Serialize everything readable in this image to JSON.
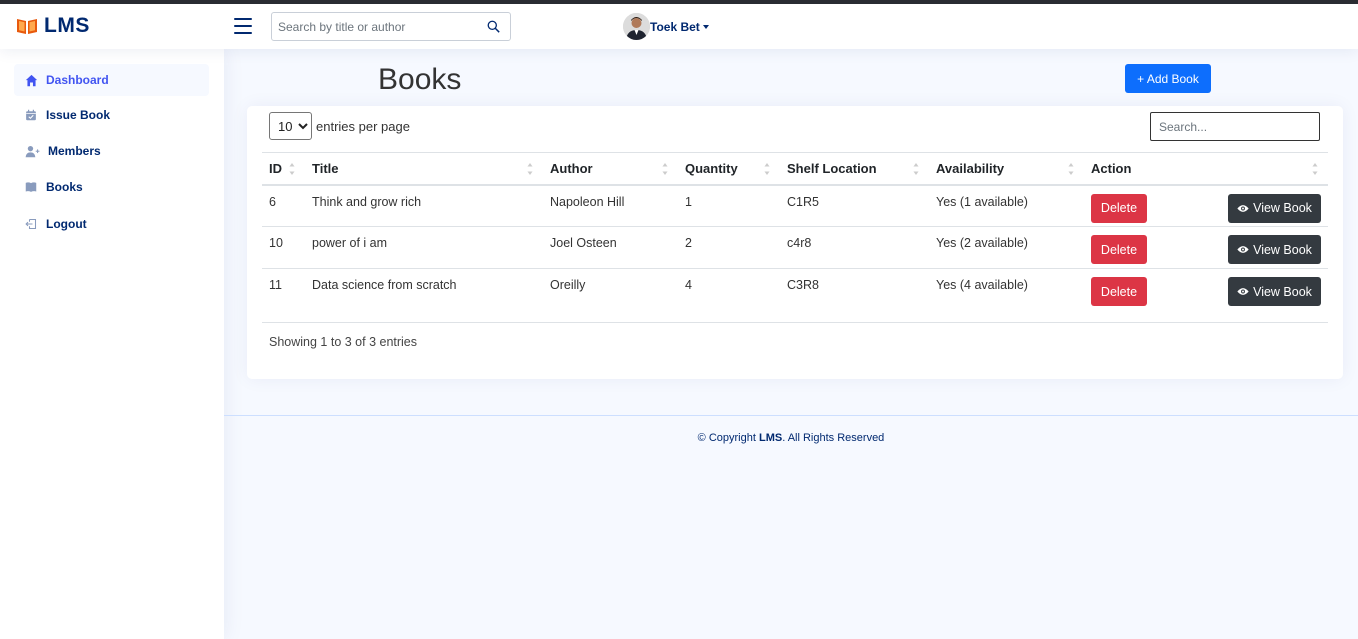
{
  "app": {
    "name": "LMS"
  },
  "header": {
    "search_placeholder": "Search by title or author",
    "user_name": "Toek Bet"
  },
  "sidebar": {
    "items": [
      {
        "label": "Dashboard",
        "icon": "house-icon"
      },
      {
        "label": "Issue Book",
        "icon": "calendar-check-icon"
      },
      {
        "label": "Members",
        "icon": "person-add-icon"
      },
      {
        "label": "Books",
        "icon": "book-icon"
      },
      {
        "label": "Logout",
        "icon": "box-arrow-left-icon"
      }
    ]
  },
  "main": {
    "title": "Books",
    "add_button": "+ Add Book",
    "entries_value": "10",
    "entries_label": "entries per page",
    "table_search_placeholder": "Search...",
    "columns": [
      "ID",
      "Title",
      "Author",
      "Quantity",
      "Shelf Location",
      "Availability",
      "Action"
    ],
    "rows": [
      {
        "id": "6",
        "title": "Think and grow rich",
        "author": "Napoleon Hill",
        "quantity": "1",
        "shelf": "C1R5",
        "availability": "Yes (1 available)"
      },
      {
        "id": "10",
        "title": "power of i am",
        "author": "Joel Osteen",
        "quantity": "2",
        "shelf": "c4r8",
        "availability": "Yes (2 available)"
      },
      {
        "id": "11",
        "title": "Data science from scratch",
        "author": "Oreilly",
        "quantity": "4",
        "shelf": "C3R8",
        "availability": "Yes (4 available)"
      }
    ],
    "delete_label": "Delete",
    "view_label": "View Book",
    "info": "Showing 1 to 3 of 3 entries"
  },
  "footer": {
    "prefix": "© Copyright ",
    "brand": "LMS",
    "suffix": ". All Rights Reserved"
  },
  "colors": {
    "primary": "#0d6efd",
    "danger": "#dc3545",
    "dark": "#343a40",
    "navy": "#012970",
    "active": "#4154f1"
  }
}
